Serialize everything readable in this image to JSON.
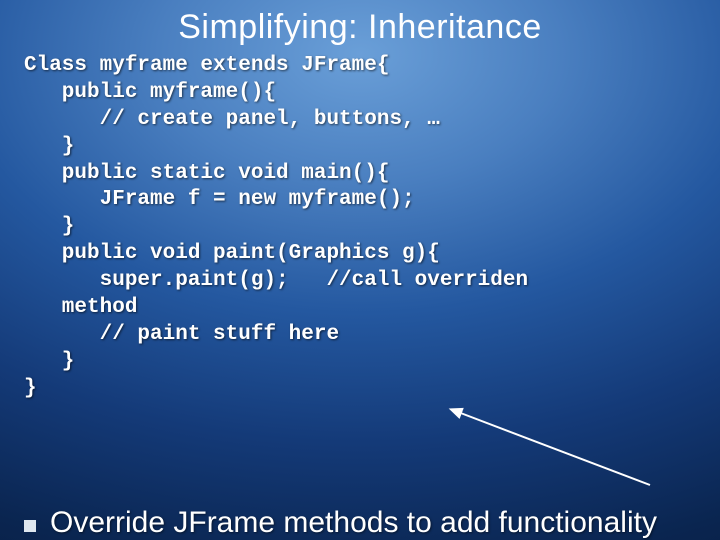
{
  "title": "Simplifying:  Inheritance",
  "code": {
    "l1": "Class myframe extends JFrame{",
    "l2": "   public myframe(){",
    "l3": "      // create panel, buttons, …",
    "l4": "   }",
    "l5": "   public static void main(){",
    "l6": "      JFrame f = new myframe();",
    "l7": "   }",
    "l8": "   public void paint(Graphics g){",
    "l9": "      super.paint(g);   //call overriden",
    "l10": "   method",
    "l11": "      // paint stuff here",
    "l12": "   }",
    "l13": "}"
  },
  "bullet": "Override JFrame methods to add functionality"
}
